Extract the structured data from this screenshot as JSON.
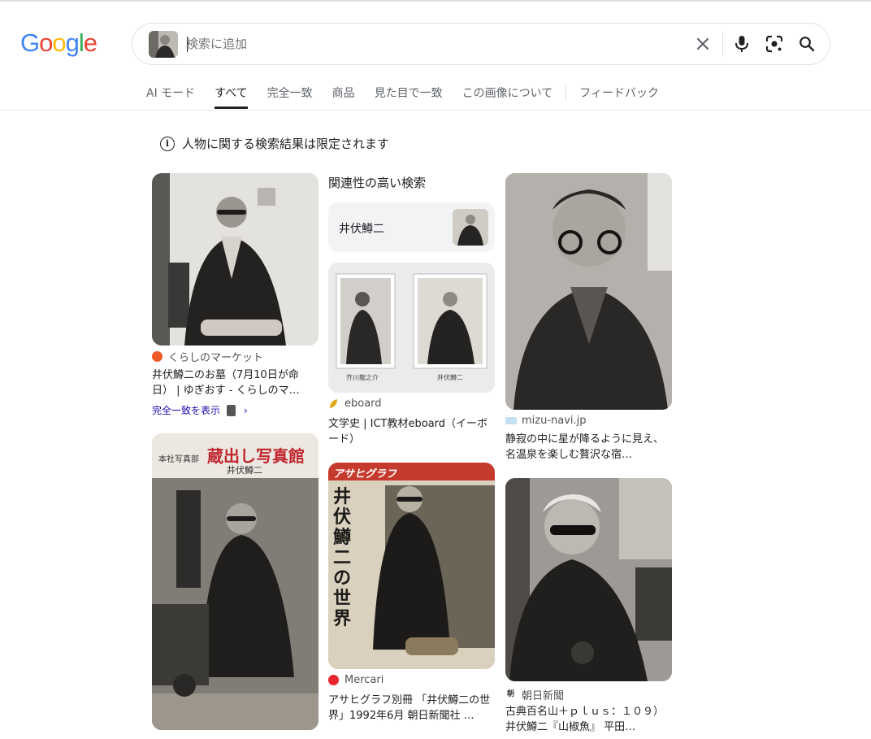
{
  "search": {
    "placeholder": "検索に追加",
    "value": ""
  },
  "tabs": [
    {
      "label": "AI モード"
    },
    {
      "label": "すべて"
    },
    {
      "label": "完全一致"
    },
    {
      "label": "商品"
    },
    {
      "label": "見た目で一致"
    },
    {
      "label": "この画像について"
    },
    {
      "label": "フィードバック"
    }
  ],
  "notice": {
    "text": "人物に関する検索結果は限定されます"
  },
  "related": {
    "title": "関連性の高い検索",
    "chip_label": "井伏鱒二"
  },
  "results": [
    {
      "source": "くらしのマーケット",
      "title": "井伏鱒二のお墓（7月10日が命日） | ゆぎおす - くらしのマ…",
      "exact_link": "完全一致を表示"
    },
    {
      "source": "eboard",
      "title": "文学史 | ICT教材eboard（イーボード）",
      "caption_left": "芥川龍之介",
      "caption_right": "井伏鱒二"
    },
    {
      "source": "mizu-navi.jp",
      "title": "静寂の中に星が降るように見え、名温泉を楽しむ贅沢な宿…"
    },
    {
      "source": "Mercari",
      "title": "アサヒグラフ別冊 「井伏鱒二の世界」1992年6月 朝日新聞社 …",
      "mag_banner": "アサヒグラフ",
      "mag_vertical": "井伏鱒二の世界"
    },
    {
      "source": "朝日新聞",
      "title": "古典百名山＋ｐｌｕｓ：１０９）井伏鱒二『山椒魚』 平田…"
    },
    {
      "mag_small": "本社写真部",
      "mag_title": "蔵出し写真館",
      "mag_sub": "井伏鱒二"
    }
  ],
  "colors": {
    "google_blue": "#4285F4",
    "google_red": "#EA4335",
    "google_yellow": "#FBBC05",
    "google_green": "#34A853",
    "link": "#1a0dab"
  }
}
